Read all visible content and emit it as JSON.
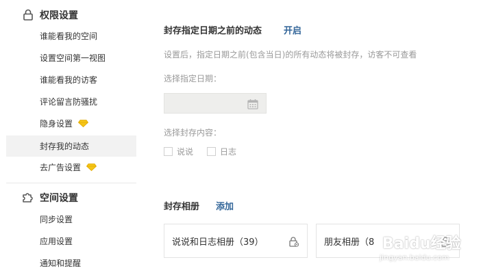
{
  "sidebar": {
    "sections": [
      {
        "title": "权限设置",
        "icon": "lock-icon",
        "items": [
          {
            "label": "谁能看我的空间"
          },
          {
            "label": "设置空间第一视图"
          },
          {
            "label": "谁能看我的访客"
          },
          {
            "label": "评论留言防骚扰"
          },
          {
            "label": "隐身设置",
            "badge": "diamond-icon"
          },
          {
            "label": "封存我的动态",
            "active": true
          },
          {
            "label": "去广告设置",
            "badge": "diamond-icon"
          }
        ]
      },
      {
        "title": "空间设置",
        "icon": "puzzle-icon",
        "items": [
          {
            "label": "同步设置"
          },
          {
            "label": "应用设置"
          },
          {
            "label": "通知和提醒"
          }
        ]
      }
    ],
    "badge_color": "#f5c518"
  },
  "main": {
    "title": "封存指定日期之前的动态",
    "toggle_label": "开启",
    "description": "设置后，指定日期之前(包含当日)的所有动态将被封存，访客不可查看",
    "date_label": "选择指定日期：",
    "date_value": "",
    "content_label": "选择封存内容：",
    "options": [
      {
        "label": "说说",
        "checked": false
      },
      {
        "label": "日志",
        "checked": false
      }
    ],
    "albums_title": "封存相册",
    "add_label": "添加",
    "albums": [
      {
        "name": "说说和日志相册（39）"
      },
      {
        "name": "朋友相册（8"
      }
    ]
  },
  "colors": {
    "link": "#336699",
    "active_bg": "#f2f2f2",
    "muted_text": "#999999"
  },
  "watermark": {
    "brand": "Baidu经验",
    "url": "jingyan.baidu.com"
  }
}
